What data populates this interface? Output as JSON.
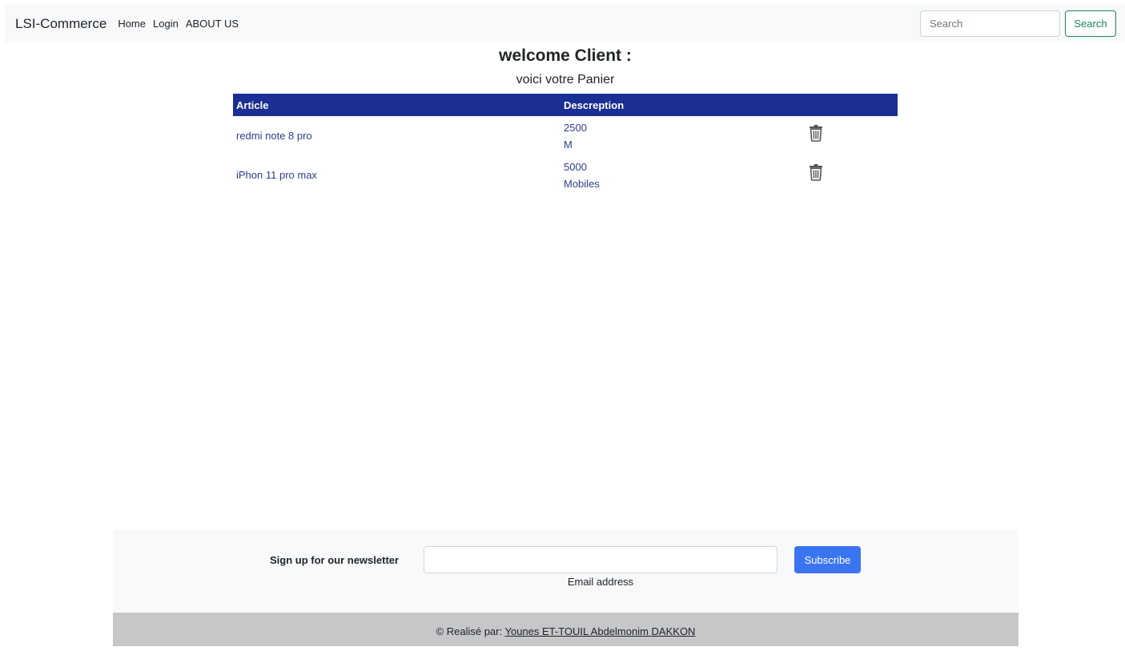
{
  "navbar": {
    "brand": "LSI-Commerce",
    "links": [
      {
        "label": "Home"
      },
      {
        "label": "Login"
      },
      {
        "label": "ABOUT US"
      }
    ],
    "search_placeholder": "Search",
    "search_button": "Search"
  },
  "page": {
    "welcome": "welcome Client :",
    "subtitle": "voici votre Panier"
  },
  "cart": {
    "headers": [
      "Article",
      "Descreption",
      ""
    ],
    "rows": [
      {
        "article": "redmi note 8 pro",
        "price": "2500",
        "category": "M",
        "action_icon": "trash-icon"
      },
      {
        "article": "iPhon 11 pro max",
        "price": "5000",
        "category": "Mobiles",
        "action_icon": "trash-icon"
      }
    ]
  },
  "newsletter": {
    "label": "Sign up for our newsletter",
    "email_value": "",
    "email_label": "Email address",
    "subscribe_button": "Subscribe"
  },
  "footer": {
    "prefix": "© Realisé par: ",
    "authors": "Younes ET-TOUIL Abdelmonim DAKKON"
  },
  "colors": {
    "table_header": "#1b2e94",
    "link_text": "#2e3d8a",
    "subscribe": "#3b74f1",
    "search_button": "#198754",
    "footer_bg": "#c6c7c9"
  }
}
